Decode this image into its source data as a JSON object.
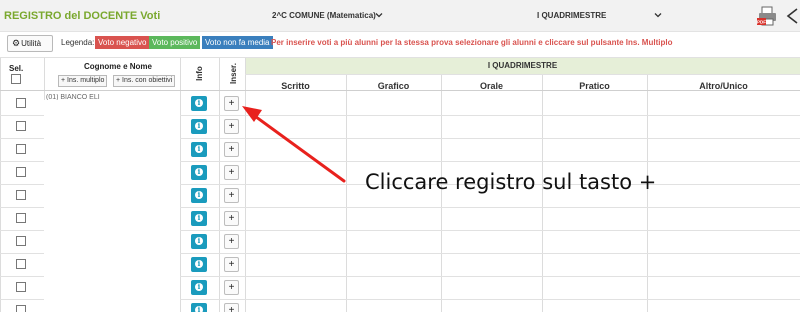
{
  "header": {
    "title": "REGISTRO del DOCENTE Voti",
    "class_select": "2^C COMUNE (Matematica)",
    "period_select": "I QUADRIMESTRE",
    "pdf_icon": "pdf-print-icon",
    "back_icon": "back-arrow-icon"
  },
  "toolbar": {
    "utility_label": "Utilità",
    "legend_label": "Legenda:",
    "badges": {
      "negative": "Voto negativo",
      "positive": "Voto positivo",
      "non_media": "Voto non fa media"
    },
    "instruction": "Per inserire voti a più alunni per la stessa prova selezionare gli alunni e cliccare sul pulsante Ins. Multiplo"
  },
  "table": {
    "sel_header": "Sel.",
    "name_header": "Cognome e Nome",
    "multi_btn": "Ins. multiplo",
    "objectives_btn": "Ins. con obiettivi",
    "info_header": "Info",
    "insert_header": "Inser.",
    "period_title": "I QUADRIMESTRE",
    "columns": [
      "Scritto",
      "Grafico",
      "Orale",
      "Pratico",
      "Altro/Unico"
    ],
    "first_row_name": "(01) BIANCO ELI",
    "row_count": 9
  },
  "annotation": {
    "text": "Cliccare registro sul tasto +"
  },
  "colors": {
    "title": "#7aa82e",
    "negative": "#d9534f",
    "positive": "#5cb85c",
    "non_media": "#3a7fbd",
    "info": "#1a9bbd",
    "arrow": "#e8211d",
    "period_band": "#e6efd8"
  }
}
